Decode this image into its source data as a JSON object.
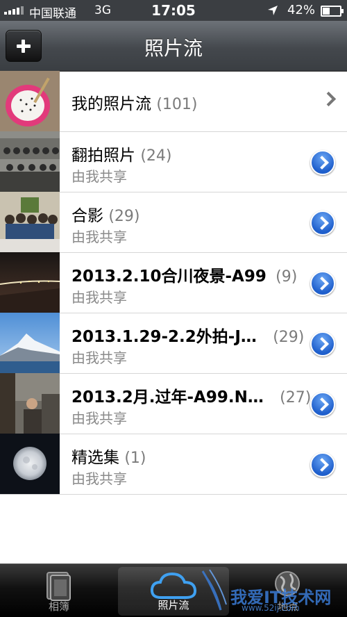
{
  "status": {
    "carrier": "中国联通",
    "network": "3G",
    "time": "17:05",
    "battery": "42%"
  },
  "nav": {
    "title": "照片流",
    "add_icon": "plus-icon"
  },
  "rows": [
    {
      "name": "我的照片流",
      "count": "(101)",
      "subtitle": "",
      "accessory": "chevron"
    },
    {
      "name": "翻拍照片",
      "count": "(24)",
      "subtitle": "由我共享",
      "accessory": "disclosure"
    },
    {
      "name": "合影",
      "count": "(29)",
      "subtitle": "由我共享",
      "accessory": "disclosure"
    },
    {
      "name": "2013.2.10合川夜景-A99",
      "count": "(9)",
      "subtitle": "由我共享",
      "accessory": "disclosure"
    },
    {
      "name": "2013.1.29-2.2外拍-J…",
      "count": "(29)",
      "subtitle": "由我共享",
      "accessory": "disclosure"
    },
    {
      "name": "2013.2月.过年-A99.N…",
      "count": "(27)",
      "subtitle": "由我共享",
      "accessory": "disclosure"
    },
    {
      "name": "精选集",
      "count": "(1)",
      "subtitle": "由我共享",
      "accessory": "disclosure"
    }
  ],
  "tabs": [
    {
      "label": "相簿",
      "icon": "albums-icon"
    },
    {
      "label": "照片流",
      "icon": "cloud-icon",
      "selected": true
    },
    {
      "label": "地点",
      "icon": "globe-icon"
    }
  ],
  "watermark": {
    "text": "我爱IT技术网",
    "url": "www.52ij.com"
  }
}
